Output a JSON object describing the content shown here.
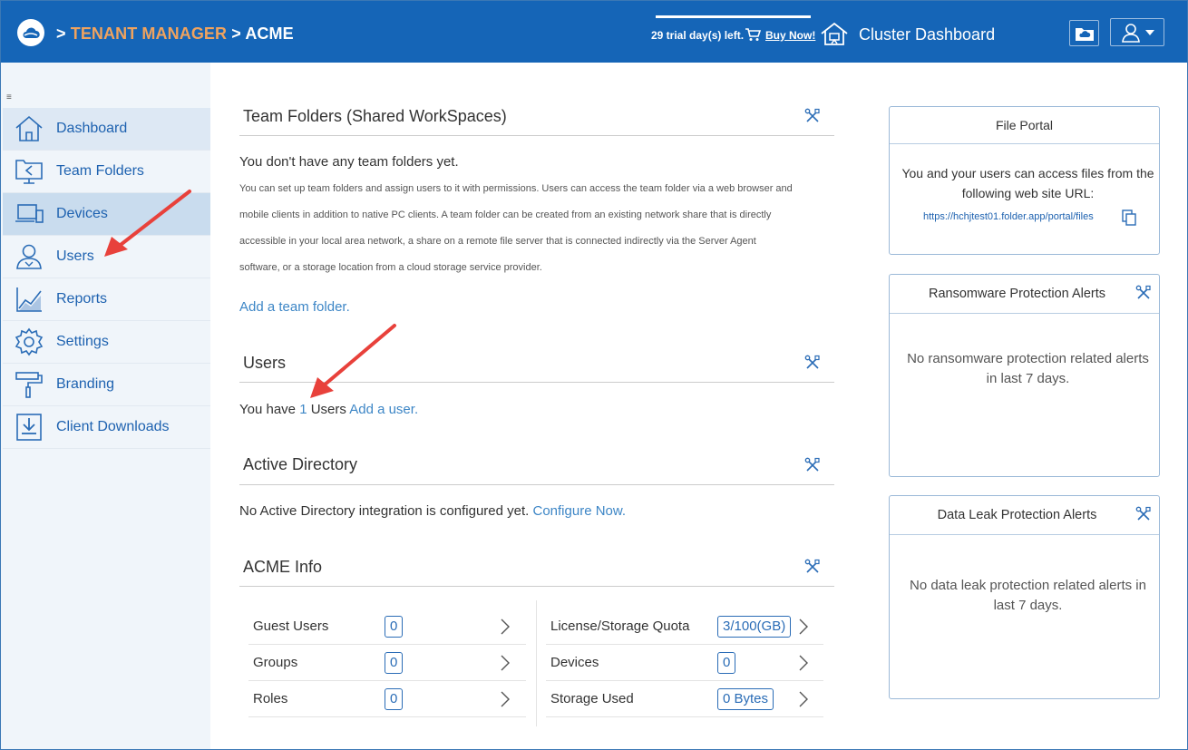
{
  "topbar": {
    "breadcrumb_sep1": ">",
    "tenant_manager": "TENANT MANAGER",
    "breadcrumb_sep2": ">",
    "tenant_name": "ACME",
    "trial_text": "29 trial day(s) left.",
    "buy_now": "Buy Now!",
    "cluster_dashboard": "Cluster Dashboard"
  },
  "sidebar": {
    "items": [
      {
        "label": "Dashboard",
        "icon": "home-icon"
      },
      {
        "label": "Team Folders",
        "icon": "team-folder-icon"
      },
      {
        "label": "Devices",
        "icon": "devices-icon"
      },
      {
        "label": "Users",
        "icon": "user-icon"
      },
      {
        "label": "Reports",
        "icon": "reports-icon"
      },
      {
        "label": "Settings",
        "icon": "gear-icon"
      },
      {
        "label": "Branding",
        "icon": "paint-roller-icon"
      },
      {
        "label": "Client Downloads",
        "icon": "download-icon"
      }
    ]
  },
  "team_folders": {
    "title": "Team Folders (Shared WorkSpaces)",
    "empty": "You don't have any team folders yet.",
    "desc_lines": [
      "You can set up team folders and assign users to it with permissions. Users can access the team folder via a web browser and",
      "mobile clients in addition to native PC clients. A team folder can be created from an existing network share that is directly",
      "accessible in your local area network, a share on a remote file server that is connected indirectly via the Server Agent",
      "software, or a storage location from a cloud storage service provider."
    ],
    "add_link": "Add a team folder."
  },
  "users": {
    "title": "Users",
    "prefix": "You have",
    "count": "1",
    "suffix": "Users",
    "add_link": "Add a user."
  },
  "active_directory": {
    "title": "Active Directory",
    "text": "No Active Directory integration is configured yet.",
    "link": "Configure Now."
  },
  "info": {
    "title": "ACME Info",
    "left": [
      {
        "label": "Guest Users",
        "value": "0"
      },
      {
        "label": "Groups",
        "value": "0"
      },
      {
        "label": "Roles",
        "value": "0"
      }
    ],
    "right": [
      {
        "label": "License/Storage Quota",
        "value": "3/100(GB)"
      },
      {
        "label": "Devices",
        "value": "0"
      },
      {
        "label": "Storage Used",
        "value": "0 Bytes"
      }
    ]
  },
  "file_portal": {
    "title": "File Portal",
    "line1": "You and your users can access files from the",
    "line2": "following web site URL:",
    "url": "https://hchjtest01.folder.app/portal/files"
  },
  "ransomware": {
    "title": "Ransomware Protection Alerts",
    "line1": "No ransomware protection related alerts",
    "line2": "in last 7 days."
  },
  "dataleak": {
    "title": "Data Leak Protection Alerts",
    "line1": "No data leak protection related alerts in",
    "line2": "last 7 days."
  },
  "colors": {
    "header": "#1565b7",
    "accent_orange": "#f0a35e",
    "link": "#3d86c6",
    "arrow": "#e8413b"
  }
}
